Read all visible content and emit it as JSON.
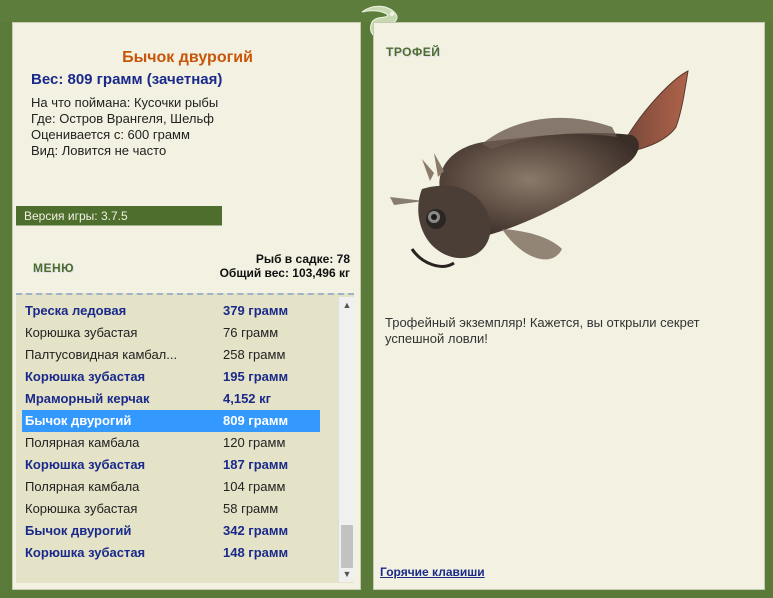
{
  "fish": {
    "title": "Бычок двурогий",
    "weight_line": "Вес: 809 грамм (зачетная)",
    "caught_on": "На что поймана: Кусочки рыбы",
    "where": "Где: Остров Врангеля, Шельф",
    "valued_from": "Оценивается с: 600 грамм",
    "frequency": "Вид: Ловится не часто"
  },
  "version": {
    "label": "Версия игры:",
    "value": "3.7.5"
  },
  "menu": {
    "label": "МЕНЮ"
  },
  "stats": {
    "fish_count": "Рыб в садке: 78",
    "total_weight": "Общий вес: 103,496 кг"
  },
  "catch_list": [
    {
      "name": "Треска ледовая",
      "weight": "379 грамм",
      "bold": true,
      "selected": false
    },
    {
      "name": "Корюшка зубастая",
      "weight": "76 грамм",
      "bold": false,
      "selected": false
    },
    {
      "name": "Палтусовидная камбал...",
      "weight": "258 грамм",
      "bold": false,
      "selected": false
    },
    {
      "name": "Корюшка зубастая",
      "weight": "195 грамм",
      "bold": true,
      "selected": false
    },
    {
      "name": "Мраморный керчак",
      "weight": "4,152 кг",
      "bold": true,
      "selected": false
    },
    {
      "name": "Бычок двурогий",
      "weight": "809 грамм",
      "bold": true,
      "selected": true
    },
    {
      "name": "Полярная камбала",
      "weight": "120 грамм",
      "bold": false,
      "selected": false
    },
    {
      "name": "Корюшка зубастая",
      "weight": "187 грамм",
      "bold": true,
      "selected": false
    },
    {
      "name": "Полярная камбала",
      "weight": "104 грамм",
      "bold": false,
      "selected": false
    },
    {
      "name": "Корюшка зубастая",
      "weight": "58 грамм",
      "bold": false,
      "selected": false
    },
    {
      "name": "Бычок двурогий",
      "weight": "342 грамм",
      "bold": true,
      "selected": false
    },
    {
      "name": "Корюшка зубастая",
      "weight": "148 грамм",
      "bold": true,
      "selected": false
    }
  ],
  "trophy": {
    "label": "ТРОФЕЙ",
    "text": "Трофейный экземпляр! Кажется, вы открыли секрет успешной ловли!"
  },
  "hotkeys": {
    "label": "Горячие клавиши"
  },
  "colors": {
    "frame_green": "#5a7a3a",
    "panel_bg": "#f2f1e2",
    "title_orange": "#c8560a",
    "bold_blue": "#1a2a8a",
    "selected_blue": "#3399ff"
  }
}
